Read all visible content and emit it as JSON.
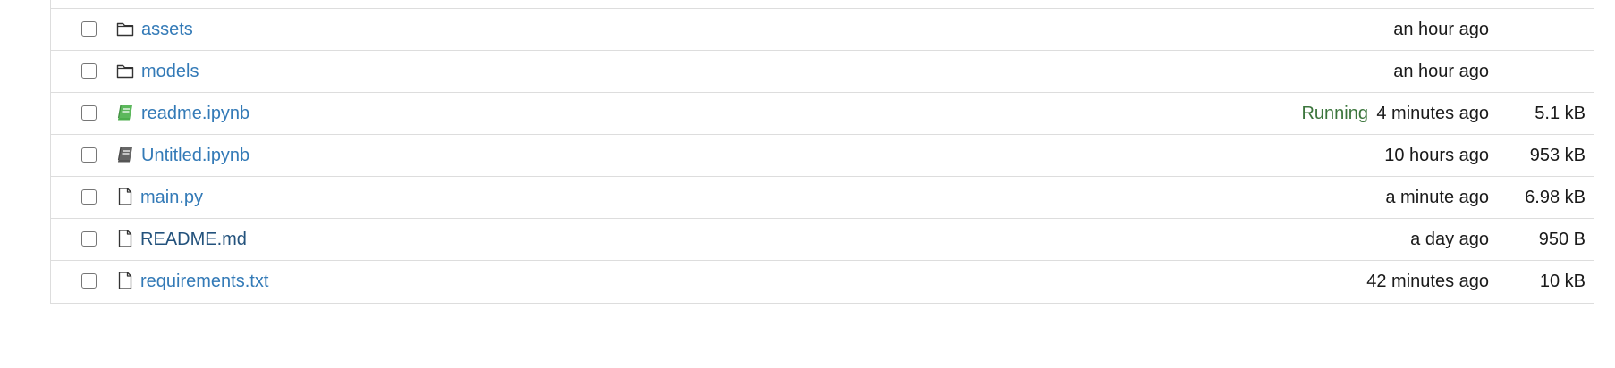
{
  "colors": {
    "link": "#337ab7",
    "link_visited_dark": "#23527c",
    "running_status": "#3c763d",
    "running_notebook_icon": "#5cb85c",
    "idle_notebook_icon": "#666666",
    "border": "#dddddd"
  },
  "files": [
    {
      "icon": "folder-icon",
      "name": "assets",
      "status": "",
      "modified": "an hour ago",
      "size": ""
    },
    {
      "icon": "folder-icon",
      "name": "models",
      "status": "",
      "modified": "an hour ago",
      "size": ""
    },
    {
      "icon": "notebook-running-icon",
      "name": "readme.ipynb",
      "status": "Running",
      "modified": "4 minutes ago",
      "size": "5.1 kB"
    },
    {
      "icon": "notebook-icon",
      "name": "Untitled.ipynb",
      "status": "",
      "modified": "10 hours ago",
      "size": "953 kB"
    },
    {
      "icon": "file-icon",
      "name": "main.py",
      "status": "",
      "modified": "a minute ago",
      "size": "6.98 kB"
    },
    {
      "icon": "file-icon",
      "name": "README.md",
      "status": "",
      "modified": "a day ago",
      "size": "950 B"
    },
    {
      "icon": "file-icon",
      "name": "requirements.txt",
      "status": "",
      "modified": "42 minutes ago",
      "size": "10 kB"
    }
  ]
}
